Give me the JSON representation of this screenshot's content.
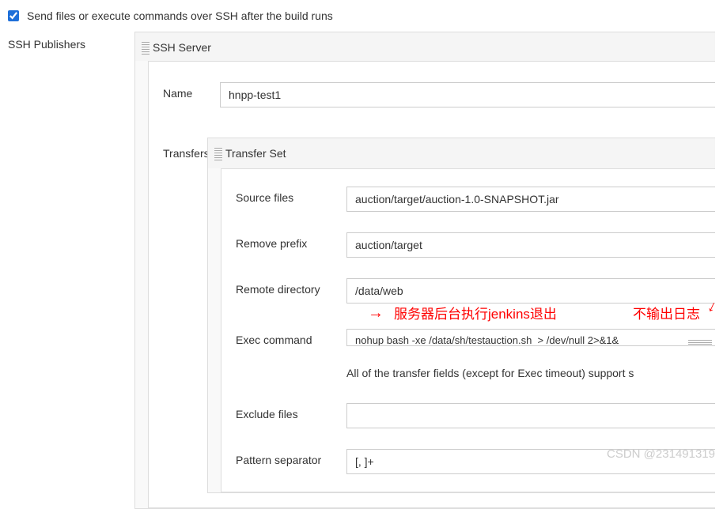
{
  "checkbox": {
    "label": "Send files or execute commands over SSH after the build runs",
    "checked": true
  },
  "publishers_label": "SSH Publishers",
  "server": {
    "header": "SSH Server",
    "name_label": "Name",
    "name_value": "hnpp-test1"
  },
  "transfers_label": "Transfers",
  "transfer_set": {
    "header": "Transfer Set",
    "source_files_label": "Source files",
    "source_files_value": "auction/target/auction-1.0-SNAPSHOT.jar",
    "remove_prefix_label": "Remove prefix",
    "remove_prefix_value": "auction/target",
    "remote_directory_label": "Remote directory",
    "remote_directory_value": "/data/web",
    "exec_command_label": "Exec command",
    "exec_command_value": "nohup bash -xe /data/sh/testauction.sh  > /dev/null 2>&1&",
    "info_text": "All of the transfer fields (except for Exec timeout) support s",
    "exclude_files_label": "Exclude files",
    "exclude_files_value": "",
    "pattern_separator_label": "Pattern separator",
    "pattern_separator_value": "[, ]+"
  },
  "annotations": {
    "anno1": "服务器后台执行jenkins退出",
    "anno2": "不输出日志"
  },
  "watermark": "CSDN @231491319"
}
